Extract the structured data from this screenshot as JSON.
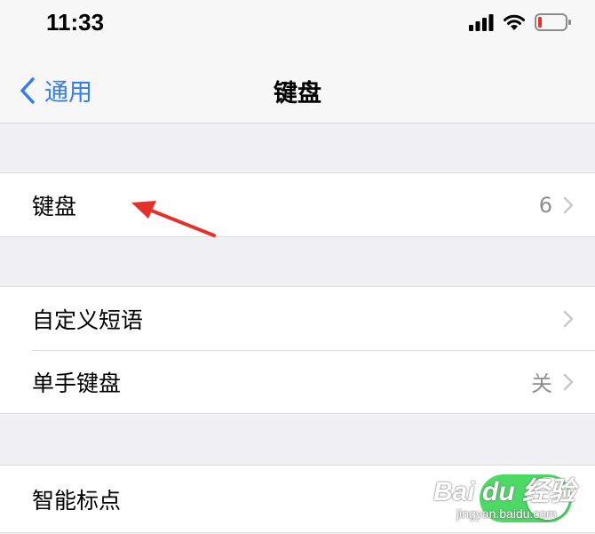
{
  "status_bar": {
    "time": "11:33",
    "icons": [
      "cellular-signal-icon",
      "wifi-icon",
      "battery-low-icon"
    ]
  },
  "nav": {
    "back_label": "通用",
    "title": "键盘"
  },
  "groups": [
    {
      "cells": [
        {
          "label": "键盘",
          "value": "6"
        }
      ]
    },
    {
      "cells": [
        {
          "label": "自定义短语",
          "value": ""
        },
        {
          "label": "单手键盘",
          "value": "关"
        }
      ]
    },
    {
      "cells": [
        {
          "label": "智能标点",
          "toggle_on": true
        }
      ]
    }
  ],
  "annotation": {
    "color": "#e8302a"
  },
  "watermark": {
    "brand": "Bai du 经验",
    "url": "jingyan.baidu.com"
  },
  "colors": {
    "accent": "#2f7cf6",
    "toggle_on": "#4cd964",
    "background": "#efeff4"
  }
}
